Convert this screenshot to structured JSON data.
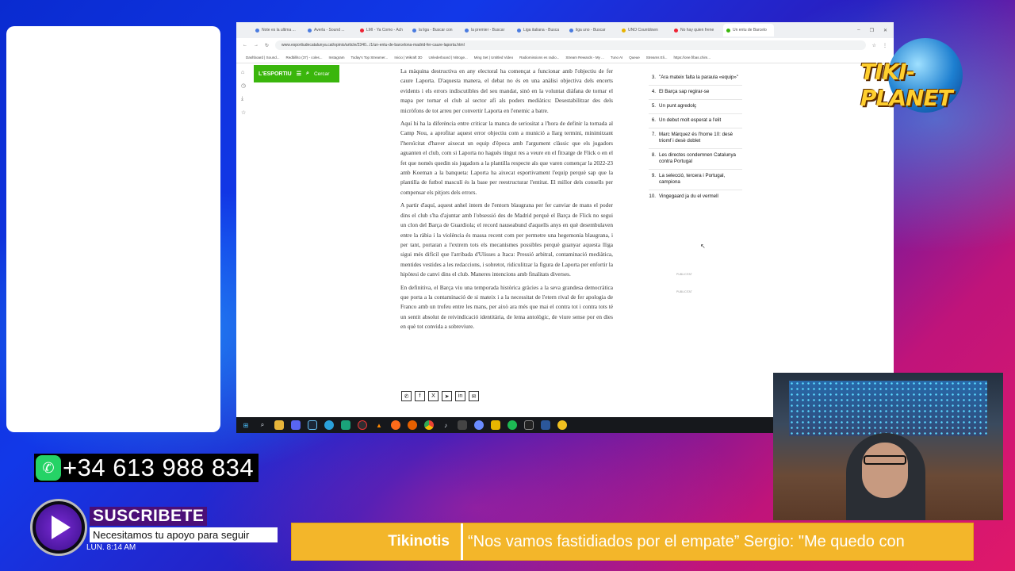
{
  "browser": {
    "tabs": [
      "Note es la ultima ...",
      "Averla - Sound ...",
      "LMI - Ya Como - Ach",
      "la liga - Buscar con",
      "la premier - Buscar",
      "Liga italiana - Busca",
      "liga uno - Buscar",
      "UNO Countdown",
      "No hay quien frene",
      "Un entu de Barcelo"
    ],
    "url": "www.esportiudecatalunya.cat/opinio/article/2340.../1/un-entu-de-barcelona-madrid-fer-caure-laporta.html",
    "bookmarks": [
      "Dashboard | Sound...",
      "Redbillito (37) - coles...",
      "Instagram",
      "Today's Top Streamer...",
      "Inicio | Wikraft 3D",
      "Unlederboard | Nitroge...",
      "Ming Set | Untitled Video",
      "Radiomissions es radio...",
      "Stream Rewards - My ...",
      "Tuno AI",
      "Queue",
      "Streams Eli...",
      "https://one.f/bas.chim..."
    ],
    "site_logo": "L'ESPORTIU",
    "search_label": "Cercar"
  },
  "article": {
    "paragraphs": [
      "La màquina destructiva en any electoral ha començat a funcionar amb l'objectiu de fer caure Laporta. D'aquesta manera, el debat no és en una anàlisi objectiva dels encerts evidents i els errors indiscutibles del seu mandat, sinó en la voluntat diàfana de tornar el mapa per tornar el club al sector afí als poders mediàtics: Desestabilitzar des dels micròfons de tot arreu per convertir Laporta en l'enemic a batre.",
      "Aquí hi ha la diferència entre criticar la manca de seriositat a l'hora de definir la tornada al Camp Nou, a aprofitar aquest error objectiu com a munició a llarg termini, minimitzant l'heroïcitat d'haver aixecat un equip d'època amb l'argument clàssic que els jugadors aguanten el club, com si Laporta no haguès tingut res a veure en el fitxatge de Flick o en el fet que només quedin sis jugadors a la plantilla respecte als que varen començar la 2022-23 amb Koeman a la banqueta: Laporta ha aixecat esportivament l'equip perquè sap que la plantilla de futbol masculí és la base per reestructurar l'entitat. El millor dels consells per compensar els pitjors dels errors.",
      "A partir d'aquí, aquest anhel intern de l'entorn blaugrana per fer canviar de mans el poder dins el club s'ha d'ajuntar amb l'obsessió des de Madrid perquè el Barça de Flick no segui un clon del Barça de Guardiola; el record nauseabund d'aquells anys en què desembulaven entre la ràbia i la violència és massa recent com per permetre una hegemonia blaugrana, i per tant, portaran a l'extrem tots els mecanismes possibles perquè guanyar aquesta lliga sigui més difícil que l'arribada d'Ulisses a Itaca: Pressió arbitral, contaminació mediàtica, mentides vestides a les redaccions, i sobretot, ridiculitzar la figura de Laporta per enfortir la hipòtesi de canvi dins el club. Maneres intencions amb finalitats diverses.",
      "En definitiva, el Barça viu una temporada històrica gràcies a la seva grandesa democràtica que porta a la contaminació de si mateix i a la necessitat de l'etern rival de fer apologia de Franco amb un trofeu entre les mans, per això ara més que mai el contra tot i contra tots té un sentit absolut de reivindicació identitària, de lema antològic, de viure sense por en dies en què tot convida a sobreviure."
    ],
    "share_icons": [
      "whatsapp-icon",
      "facebook-icon",
      "x-icon",
      "telegram-icon",
      "linkedin-icon",
      "email-icon"
    ],
    "share_glyphs": [
      "✆",
      "f",
      "X",
      "➤",
      "in",
      "✉"
    ]
  },
  "ranking": [
    {
      "num": "3.",
      "title": "\"Ara mateix falta la paraula «equip»\""
    },
    {
      "num": "4.",
      "title": "El Barça sap regirar-se"
    },
    {
      "num": "5.",
      "title": "Un punt agredolç"
    },
    {
      "num": "6.",
      "title": "Un debut molt esperat a l'elit"
    },
    {
      "num": "7.",
      "title": "Marc Márquez és l'home 10: desè triomf i desè doblet"
    },
    {
      "num": "8.",
      "title": "Les directes condemnen Catalunya contra Portugal"
    },
    {
      "num": "9.",
      "title": "La selecció, tercera i Portugal, campiona"
    },
    {
      "num": "10.",
      "title": "Vingegaard ja du el vermell"
    }
  ],
  "ads": [
    "PUBLICITAT",
    "PUBLICITAT"
  ],
  "overlay": {
    "brand": "TIKI-PLANET",
    "phone": "+34 613 988 834",
    "subscribe": "SUSCRIBETE",
    "subscribe_sub": "Necesitamos tu apoyo para seguir",
    "clock": "LUN. 8:14 AM",
    "ticker_label": "Tikinotis",
    "ticker_text": "“Nos vamos fastidiados por el empate”    Sergio: \"Me quedo con"
  },
  "taskbar": [
    "windows-icon",
    "search-icon",
    "file-explorer-icon",
    "discord-icon",
    "steam-icon",
    "telegram-icon",
    "app-icon",
    "obs-icon",
    "vlc-icon",
    "app-icon-2",
    "firefox-icon",
    "chrome-icon",
    "tiktok-icon",
    "app-icon-3",
    "app-icon-4",
    "app-icon-5",
    "spotify-icon",
    "app-icon-6",
    "word-icon",
    "app-icon-7"
  ]
}
